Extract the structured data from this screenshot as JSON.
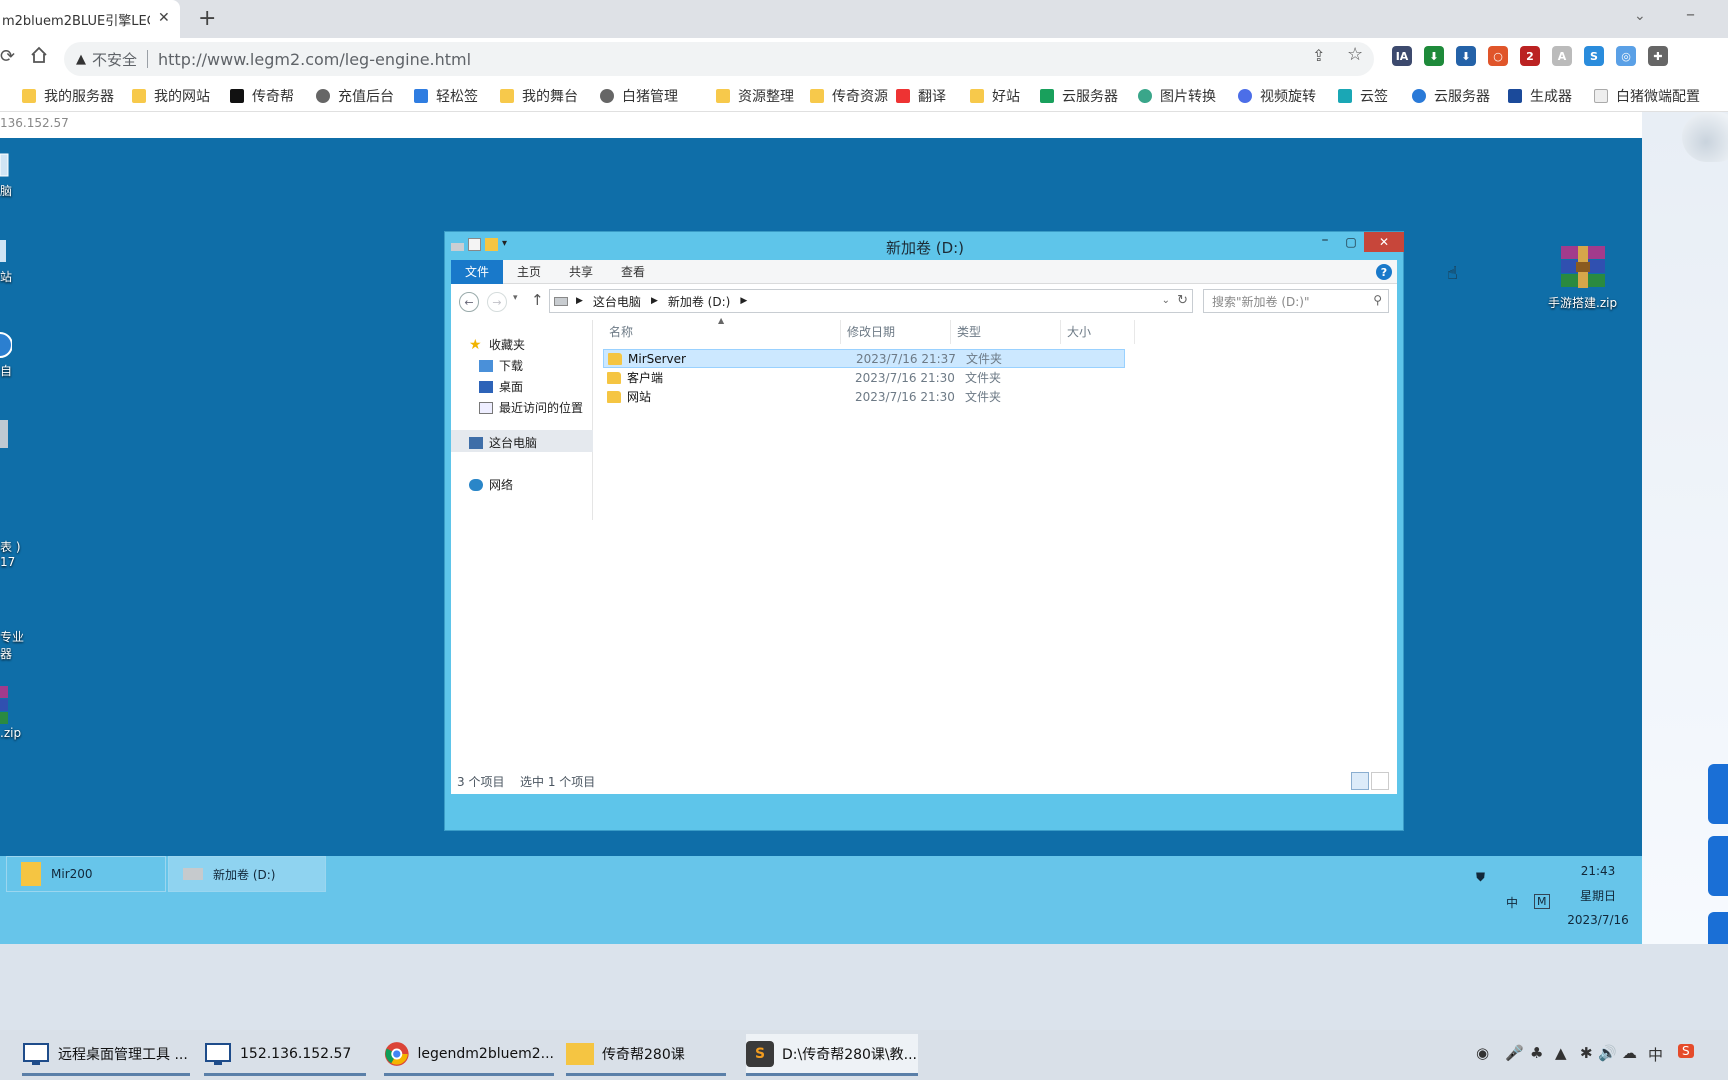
{
  "browser": {
    "tab_title": "m2bluem2BLUE引擎LEG",
    "tab_close": "✕",
    "new_tab": "+",
    "insecure_label": "不安全",
    "url": "http://www.legm2.com/leg-engine.html",
    "extensions": [
      {
        "name": "ia",
        "text": "IA",
        "color": "#3d4a6e"
      },
      {
        "name": "download-arrow",
        "text": "⬇",
        "color": "#1e8a3a"
      },
      {
        "name": "download-box",
        "text": "⬇",
        "color": "#2462a8"
      },
      {
        "name": "chrome-circle",
        "text": "○",
        "color": "#e0552a"
      },
      {
        "name": "shield-badge",
        "text": "2",
        "color": "#b22"
      },
      {
        "name": "a-logo",
        "text": "A",
        "color": "#bbb"
      },
      {
        "name": "swirl-blue",
        "text": "S",
        "color": "#2a8cdc"
      },
      {
        "name": "ring-blue",
        "text": "◎",
        "color": "#5aa0e6"
      },
      {
        "name": "puzzle",
        "text": "✚",
        "color": "#666"
      }
    ],
    "bookmarks": [
      {
        "label": "我的服务器",
        "icon": "folder"
      },
      {
        "label": "我的网站",
        "icon": "folder"
      },
      {
        "label": "传奇帮",
        "icon": "tiktok"
      },
      {
        "label": "充值后台",
        "icon": "globe"
      },
      {
        "label": "轻松签",
        "icon": "blue-square"
      },
      {
        "label": "我的舞台",
        "icon": "folder"
      },
      {
        "label": "白猪管理",
        "icon": "globe"
      },
      {
        "label": "资源整理",
        "icon": "folder"
      },
      {
        "label": "传奇资源",
        "icon": "folder"
      },
      {
        "label": "翻译",
        "icon": "youdao"
      },
      {
        "label": "好站",
        "icon": "folder"
      },
      {
        "label": "云服务器",
        "icon": "green-sheet"
      },
      {
        "label": "图片转换",
        "icon": "gear-green"
      },
      {
        "label": "视频旋转",
        "icon": "blue-circle"
      },
      {
        "label": "云签",
        "icon": "x-teal"
      },
      {
        "label": "云服务器",
        "icon": "swirl"
      },
      {
        "label": "生成器",
        "icon": "kt"
      },
      {
        "label": "白猪微端配置",
        "icon": "page"
      }
    ]
  },
  "remote": {
    "ip_label": "136.152.57",
    "desktop_icons": [
      {
        "label": "脑"
      },
      {
        "label": "站"
      },
      {
        "label": "自"
      },
      {
        "label": ""
      },
      {
        "label": "表 )\n17"
      },
      {
        "label": "专业\n器"
      },
      {
        "label": ".zip"
      }
    ],
    "zip_file": "手游搭建.zip",
    "explorer": {
      "title": "新加卷 (D:)",
      "ribbon_tabs": [
        "文件",
        "主页",
        "共享",
        "查看"
      ],
      "help": "?",
      "breadcrumb": [
        "这台电脑",
        "新加卷 (D:)"
      ],
      "search_placeholder": "搜索\"新加卷 (D:)\"",
      "nav": {
        "favorites": "收藏夹",
        "downloads": "下载",
        "desktop": "桌面",
        "recent": "最近访问的位置",
        "this_pc": "这台电脑",
        "network": "网络"
      },
      "columns": [
        "名称",
        "修改日期",
        "类型",
        "大小"
      ],
      "files": [
        {
          "name": "MirServer",
          "date": "2023/7/16 21:37",
          "type": "文件夹",
          "selected": true
        },
        {
          "name": "客户端",
          "date": "2023/7/16 21:30",
          "type": "文件夹",
          "selected": false
        },
        {
          "name": "网站",
          "date": "2023/7/16 21:30",
          "type": "文件夹",
          "selected": false
        }
      ],
      "status_count": "3 个项目",
      "status_selected": "选中 1 个项目"
    },
    "taskbar": {
      "items": [
        "Mir200",
        "新加卷 (D:)"
      ],
      "time": "21:43",
      "weekday": "星期日",
      "date": "2023/7/16",
      "ime": "中",
      "ime_mode": "M"
    }
  },
  "host_taskbar": {
    "items": [
      {
        "label": "远程桌面管理工具 ..."
      },
      {
        "label": "152.136.152.57"
      },
      {
        "label": "legendm2bluem2..."
      },
      {
        "label": "传奇帮280课"
      },
      {
        "label": "D:\\传奇帮280课\\教..."
      }
    ],
    "ime": "中"
  }
}
